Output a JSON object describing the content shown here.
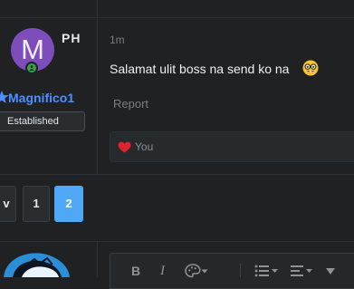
{
  "post": {
    "author": {
      "avatar_letter": "M",
      "initials": "PH",
      "username": "Magnifico1",
      "user_title": "Established",
      "avatar_color": "#7c4dbb",
      "online_color": "#36a447",
      "username_color": "#4f8fff"
    },
    "time": "1m",
    "message": "Salamat ulit boss na send ko na",
    "emoji_icon": "nerd-face-emoji",
    "report_label": "Report",
    "reaction": {
      "icon": "heart-icon",
      "users": "You",
      "heart_color": "#e0242b"
    }
  },
  "pagination": {
    "prev_label": "v",
    "pages": [
      "1",
      "2"
    ],
    "current_page": "2",
    "accent_color": "#4ea8f5"
  },
  "editor": {
    "toolbar": {
      "bold_label": "B",
      "italic_label": "I",
      "icons": [
        "bold-icon",
        "italic-icon",
        "color-palette-icon",
        "list-icon",
        "align-icon",
        "more-icon"
      ]
    }
  }
}
